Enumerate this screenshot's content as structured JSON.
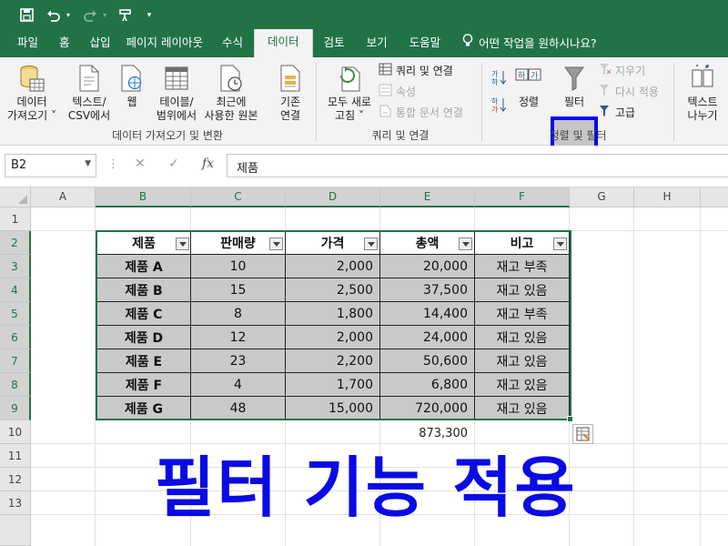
{
  "titlebar": {
    "icons": [
      "save-icon",
      "undo-icon",
      "undo-dropdown-icon",
      "redo-icon",
      "redo-dropdown-icon",
      "format-painter-icon",
      "customize-qat-icon"
    ]
  },
  "tabs": [
    "파일",
    "홈",
    "삽입",
    "페이지 레이아웃",
    "수식",
    "데이터",
    "검토",
    "보기",
    "도움말"
  ],
  "active_tab": "데이터",
  "tell_me": "어떤 작업을 원하시나요?",
  "ribbon": {
    "get_data": [
      "데이터",
      "가져오기 ˅"
    ],
    "text_csv": [
      "텍스트/",
      "CSV에서"
    ],
    "web": "웹",
    "table_range": [
      "테이블/",
      "범위에서"
    ],
    "recent_sources": [
      "최근에",
      "사용한 원본"
    ],
    "existing_conn": [
      "기존",
      "연결"
    ],
    "group_get_transform": "데이터 가져오기 및 변환",
    "refresh_all": [
      "모두 새로",
      "고침 ˅"
    ],
    "queries_connections": "쿼리 및 연결",
    "properties": "속성",
    "edit_links": "통합 문서 연결",
    "group_queries": "쿼리 및 연결",
    "sort": "정렬",
    "filter": "필터",
    "clear": "지우기",
    "reapply": "다시 적용",
    "advanced": "고급",
    "group_sort_filter": "정렬 및 필터",
    "text_to_columns": [
      "텍스트",
      "나누기"
    ],
    "colors": {
      "excel_green": "#217346",
      "highlight": "#0000ff"
    }
  },
  "formula_bar": {
    "name_box": "B2",
    "formula": "제품"
  },
  "columns": [
    "A",
    "B",
    "C",
    "D",
    "E",
    "F",
    "G",
    "H"
  ],
  "rows": [
    "1",
    "2",
    "3",
    "4",
    "5",
    "6",
    "7",
    "8",
    "9",
    "10",
    "11",
    "12",
    "13"
  ],
  "table": {
    "headers": [
      "제품",
      "판매량",
      "가격",
      "총액",
      "비고"
    ],
    "rows": [
      [
        "제품 A",
        "10",
        "2,000",
        "20,000",
        "재고 부족"
      ],
      [
        "제품 B",
        "15",
        "2,500",
        "37,500",
        "재고 있음"
      ],
      [
        "제품 C",
        "8",
        "1,800",
        "14,400",
        "재고 부족"
      ],
      [
        "제품 D",
        "12",
        "2,000",
        "24,000",
        "재고 있음"
      ],
      [
        "제품 E",
        "23",
        "2,200",
        "50,600",
        "재고 있음"
      ],
      [
        "제품 F",
        "4",
        "1,700",
        "6,800",
        "재고 있음"
      ],
      [
        "제품 G",
        "48",
        "15,000",
        "720,000",
        "재고 있음"
      ]
    ],
    "total": "873,300"
  },
  "overlay_title": "필터 기능 적용"
}
